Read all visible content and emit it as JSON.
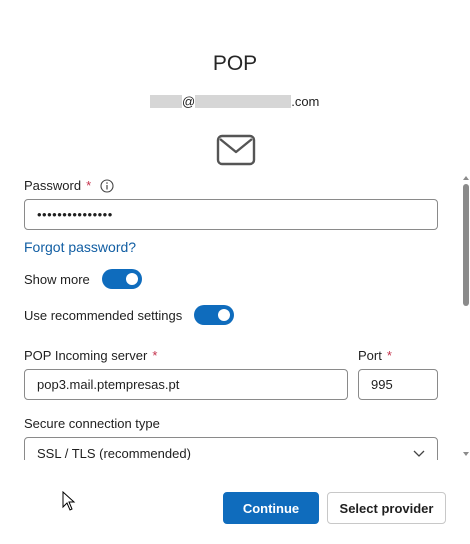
{
  "dialog": {
    "title": "POP",
    "email": {
      "at": "@",
      "domain_suffix": ".com"
    },
    "icon": "mail-icon"
  },
  "form": {
    "password": {
      "label": "Password",
      "required_mark": "*",
      "value": "•••••••••••••••"
    },
    "forgot_password": "Forgot password?",
    "show_more": {
      "label": "Show more",
      "on": true
    },
    "recommended": {
      "label": "Use recommended settings",
      "on": true
    },
    "server": {
      "label": "POP Incoming server",
      "required_mark": "*",
      "value": "pop3.mail.ptempresas.pt"
    },
    "port": {
      "label": "Port",
      "required_mark": "*",
      "value": "995"
    },
    "secure": {
      "label": "Secure connection type",
      "value": "SSL / TLS (recommended)"
    }
  },
  "actions": {
    "continue": "Continue",
    "select_provider": "Select provider"
  },
  "colors": {
    "accent": "#0f6cbd",
    "link": "#115ea3",
    "required": "#c4314b"
  }
}
